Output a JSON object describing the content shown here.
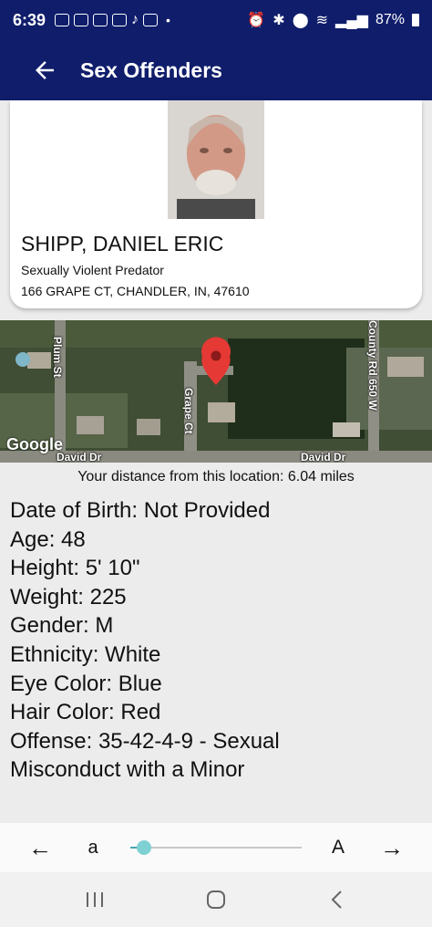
{
  "status_bar": {
    "time": "6:39",
    "notification_icons": [
      "temu-icon",
      "temu-icon",
      "mail-icon",
      "mail-icon",
      "tiktok-icon",
      "mail-icon"
    ],
    "dot": "•",
    "battery": "87%"
  },
  "app_bar": {
    "title": "Sex Offenders"
  },
  "offender": {
    "name": "SHIPP, DANIEL ERIC",
    "status": "Sexually Violent Predator",
    "address": "166 GRAPE CT, CHANDLER, IN, 47610"
  },
  "map": {
    "roads": [
      "Plum St",
      "Grape Ct",
      "County Rd 650 W",
      "David Dr",
      "David Dr"
    ],
    "logo": "Google"
  },
  "distance_text": "Your distance from this location: 6.04 miles",
  "details": [
    "Date of Birth: Not Provided",
    "Age: 48",
    "Height: 5' 10\"",
    "Weight: 225",
    "Gender: M",
    "Ethnicity: White",
    "Eye Color: Blue",
    "Hair Color: Red",
    "Offense: 35-42-4-9 - Sexual",
    "Misconduct with a Minor"
  ],
  "controls": {
    "prev_label": "←",
    "small_font_label": "a",
    "large_font_label": "A",
    "next_label": "→",
    "font_size_level": 0.08
  },
  "colors": {
    "app_bar": "#0f1d6b",
    "slider_accent": "#7fd0d3",
    "pin": "#e53935"
  }
}
